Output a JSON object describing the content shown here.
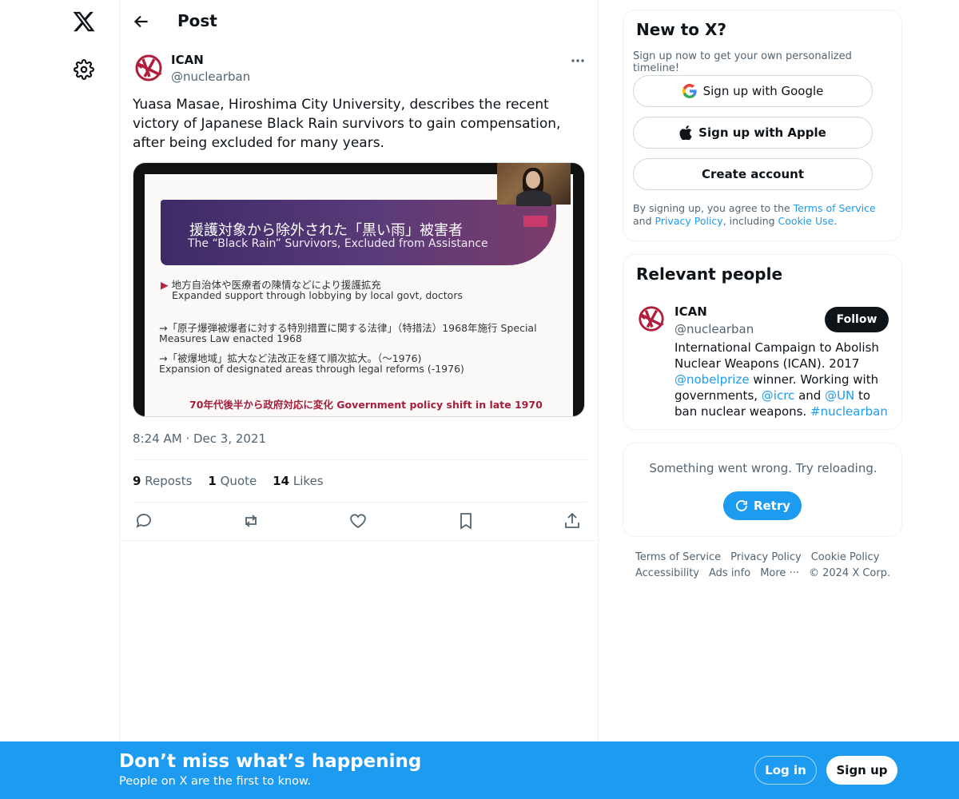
{
  "nav": {
    "logo_icon": "x-logo-icon",
    "settings_icon": "gear-icon"
  },
  "header": {
    "title": "Post",
    "back_icon": "arrow-left-icon"
  },
  "tweet": {
    "author_name": "ICAN",
    "author_handle": "@nuclearban",
    "text": "Yuasa Masae, Hiroshima City University, describes the recent victory of Japanese Black Rain survivors to gain compensation, after being excluded for many years.",
    "media": {
      "title_jp": "援護対象から除外された「黒い雨」被害者",
      "title_en": "The “Black Rain” Survivors, Excluded from Assistance",
      "line1_jp": "地方自治体や医療者の陳情などにより援護拡充",
      "line1_en": "Expanded support through lobbying by local govt, doctors",
      "line2a": "→「原子爆弾被爆者に対する特別措置に関する法律」（特措法）1968年施行 Special",
      "line2b": "Measures Law enacted 1968",
      "line3a": "→「被爆地域」拡大など法改正を経て順次拡大。（〜1976)",
      "line3b": "Expansion of designated areas through legal reforms (-1976)",
      "footer_line": "70年代後半から政府対応に変化 Government policy shift in late 1970"
    },
    "time": "8:24 AM",
    "dot": "·",
    "date": "Dec 3, 2021",
    "reposts_count": "9",
    "reposts_label": "Reposts",
    "quotes_count": "1",
    "quotes_label": "Quote",
    "likes_count": "14",
    "likes_label": "Likes"
  },
  "signup_card": {
    "title": "New to X?",
    "subtitle": "Sign up now to get your own personalized timeline!",
    "google_label": "Sign up with Google",
    "apple_label": "Sign up with Apple",
    "create_label": "Create account",
    "terms_prefix": "By signing up, you agree to the ",
    "terms_link": "Terms of Service",
    "terms_and": " and ",
    "privacy_link": "Privacy Policy",
    "terms_including": ", including ",
    "cookie_link": "Cookie Use",
    "terms_end": "."
  },
  "people_card": {
    "title": "Relevant people",
    "name": "ICAN",
    "handle": "@nuclearban",
    "follow_label": "Follow",
    "bio_1": "International Campaign to Abolish Nuclear Weapons (ICAN). 2017 ",
    "bio_link_1": "@nobelprize",
    "bio_2": " winner. Working with governments, ",
    "bio_link_2": "@icrc",
    "bio_3": " and ",
    "bio_link_3": "@UN",
    "bio_4": " to ban nuclear weapons. ",
    "bio_link_4": "#nuclearban"
  },
  "error_card": {
    "message": "Something went wrong. Try reloading.",
    "retry_label": "Retry"
  },
  "footer": {
    "links": [
      "Terms of Service",
      "Privacy Policy",
      "Cookie Policy",
      "Accessibility",
      "Ads info",
      "More ···",
      "© 2024 X Corp."
    ]
  },
  "bottom_bar": {
    "title": "Don’t miss what’s happening",
    "subtitle": "People on X are the first to know.",
    "login_label": "Log in",
    "signup_label": "Sign up"
  },
  "colors": {
    "accent": "#1d9bf0",
    "text": "#0f1419",
    "muted": "#536471",
    "ican_red": "#b01e3c"
  }
}
